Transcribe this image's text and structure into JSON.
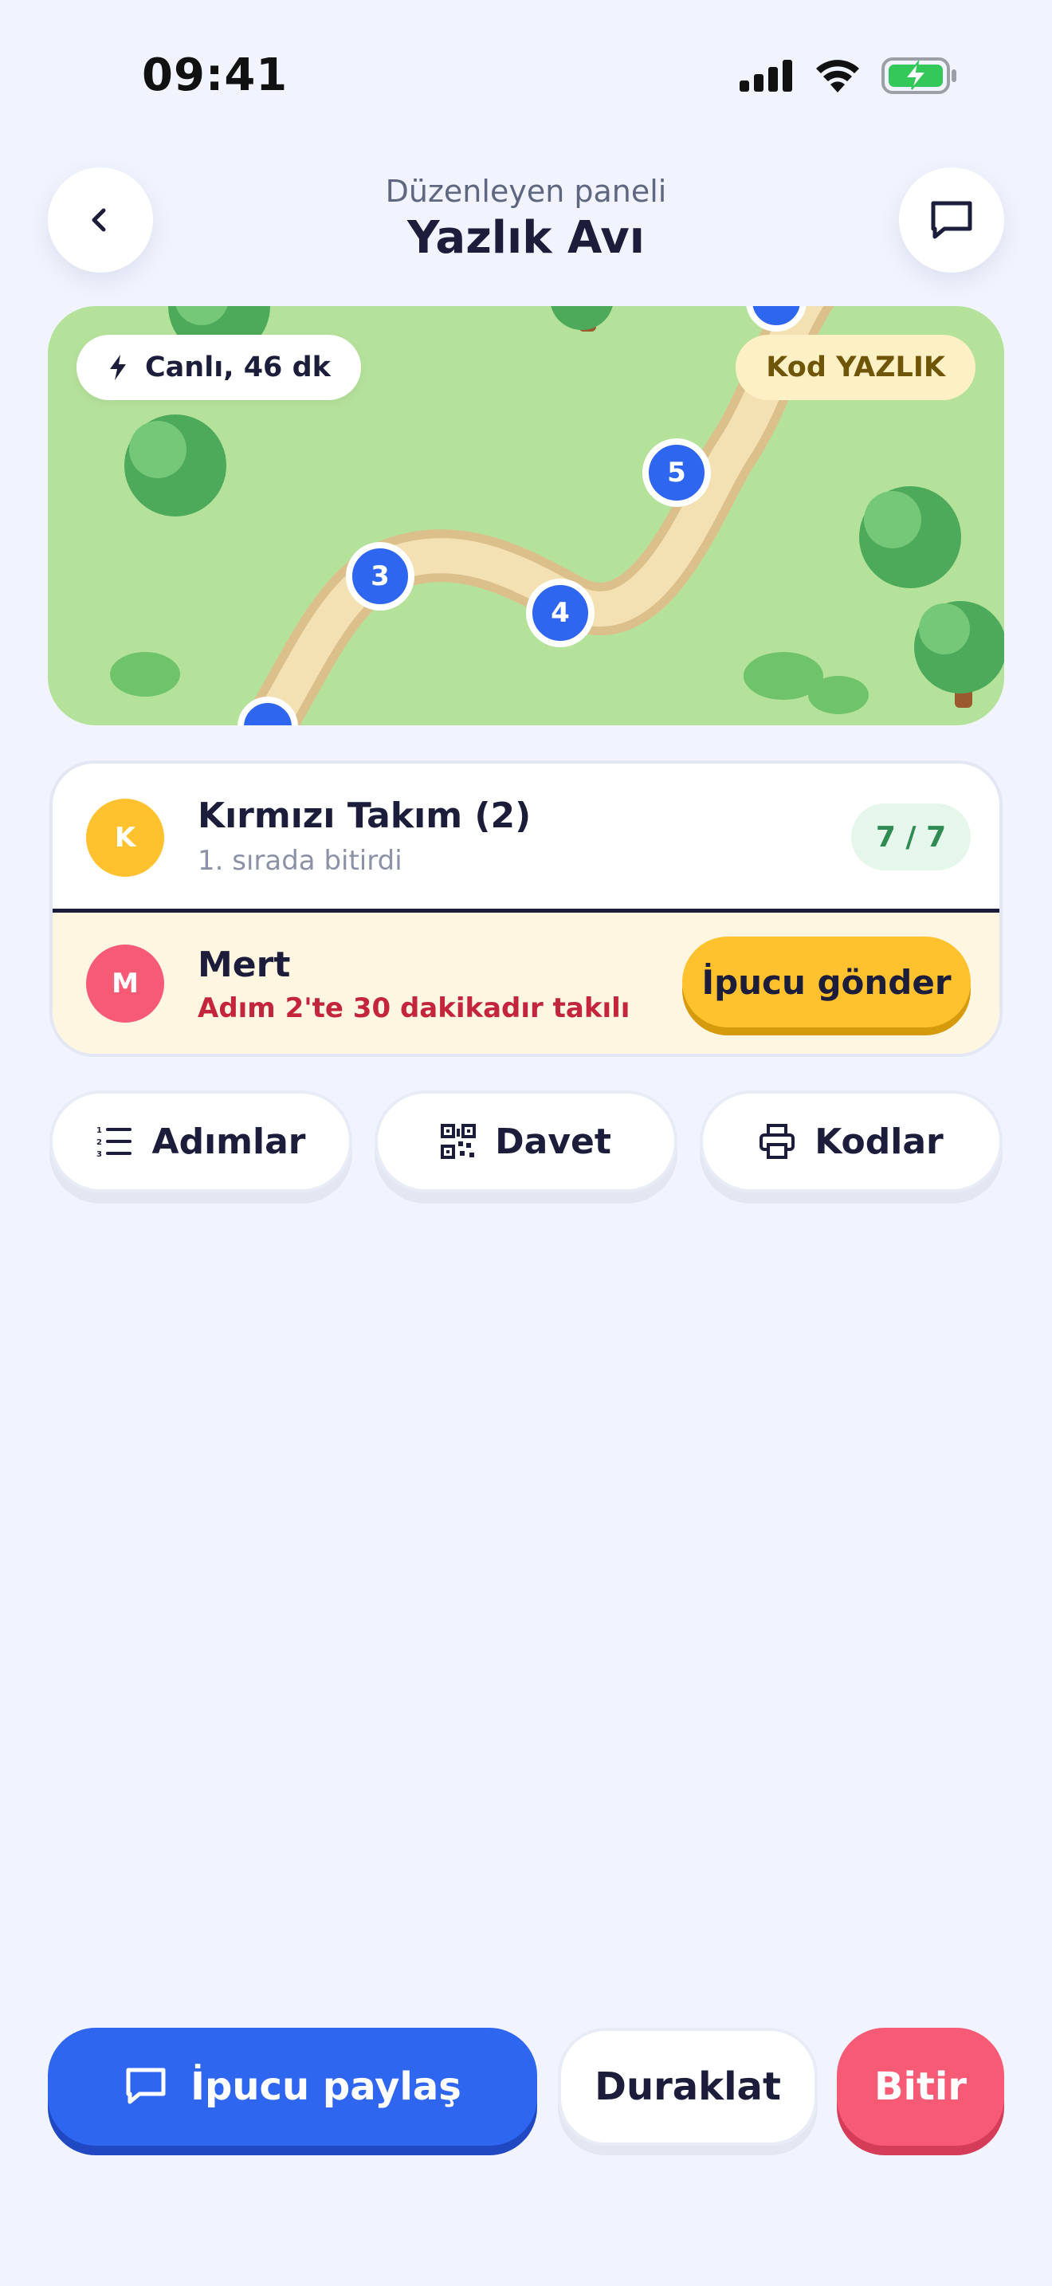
{
  "status_bar": {
    "time": "09:41"
  },
  "header": {
    "subtitle": "Düzenleyen paneli",
    "title": "Yazlık Avı",
    "back_icon": "chevron-left-icon",
    "chat_icon": "chat-bubble-icon"
  },
  "map": {
    "live_label": "Canlı, 46 dk",
    "code_label": "Kod YAZLIK",
    "markers": [
      "3",
      "4",
      "5"
    ]
  },
  "team": {
    "avatar": "K",
    "name": "Kırmızı Takım (2)",
    "status": "1. sırada bitirdi",
    "progress": "7 / 7"
  },
  "member": {
    "avatar": "M",
    "name": "Mert",
    "status": "Adım 2'te 30 dakikadır takılı",
    "action": "İpucu gönder"
  },
  "actions": {
    "steps": "Adımlar",
    "invite": "Davet",
    "codes": "Kodlar"
  },
  "bottom": {
    "share_hint": "İpucu paylaş",
    "pause": "Duraklat",
    "end": "Bitir"
  },
  "colors": {
    "primary": "#2f66f0",
    "accent": "#ffc22e",
    "danger": "#f75a75",
    "background": "#f1f4fe"
  }
}
